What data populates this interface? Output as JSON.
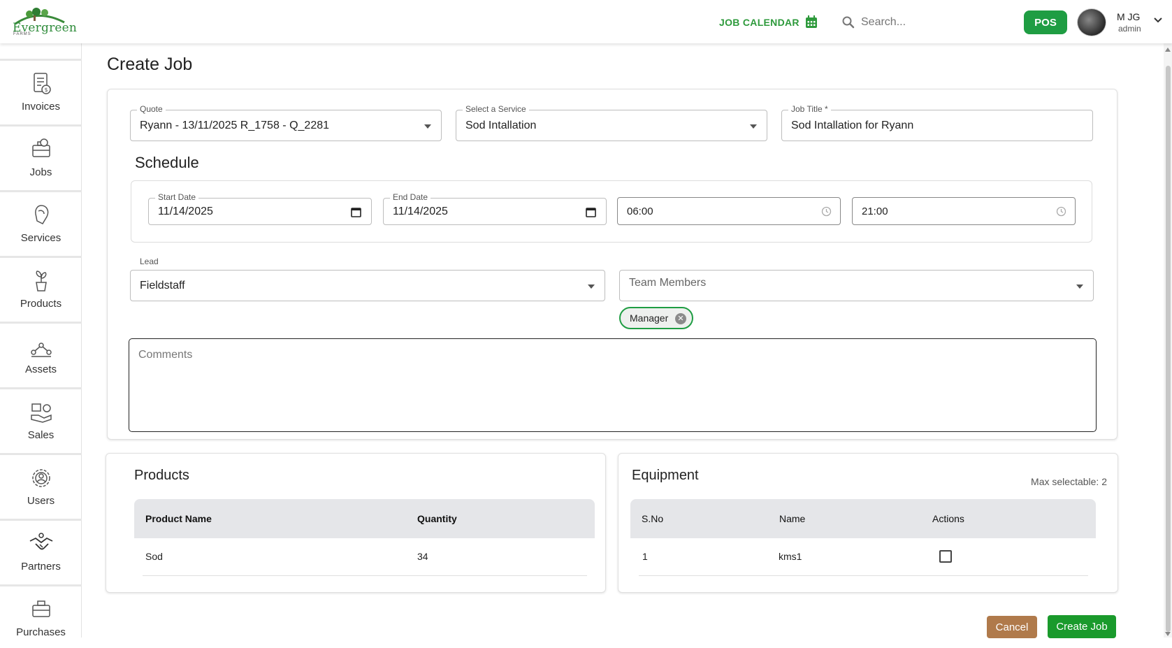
{
  "header": {
    "logo_text": "Evergreen",
    "logo_sub": "FARMS",
    "job_calendar_label": "JOB CALENDAR",
    "search_placeholder": "Search...",
    "pos_label": "POS",
    "user_name": "M JG",
    "user_role": "admin"
  },
  "sidebar": {
    "items": [
      {
        "label": "Invoices",
        "icon": "invoice-icon"
      },
      {
        "label": "Jobs",
        "icon": "jobs-icon"
      },
      {
        "label": "Services",
        "icon": "services-icon"
      },
      {
        "label": "Products",
        "icon": "plant-pot-icon"
      },
      {
        "label": "Assets",
        "icon": "assets-icon"
      },
      {
        "label": "Sales",
        "icon": "sales-icon"
      },
      {
        "label": "Users",
        "icon": "gear-users-icon"
      },
      {
        "label": "Partners",
        "icon": "handshake-icon"
      },
      {
        "label": "Purchases",
        "icon": "purchases-icon"
      }
    ]
  },
  "page": {
    "title": "Create Job"
  },
  "form": {
    "quote_label": "Quote",
    "quote_value": "Ryann - 13/11/2025 R_1758 - Q_2281",
    "service_label": "Select a Service",
    "service_value": "Sod Intallation",
    "job_title_label": "Job Title *",
    "job_title_value": "Sod Intallation for Ryann",
    "schedule_title": "Schedule",
    "start_date_label": "Start Date",
    "start_date_value": "11/14/2025",
    "end_date_label": "End Date",
    "end_date_value": "11/14/2025",
    "start_time_value": "06:00",
    "end_time_value": "21:00",
    "lead_label": "Lead",
    "lead_value": "Fieldstaff",
    "team_members_placeholder": "Team Members",
    "team_chip": "Manager",
    "comments_placeholder": "Comments"
  },
  "products": {
    "title": "Products",
    "columns": [
      "Product Name",
      "Quantity"
    ],
    "rows": [
      {
        "name": "Sod",
        "quantity": "34"
      }
    ]
  },
  "equipment": {
    "title": "Equipment",
    "max_selectable": "Max selectable: 2",
    "columns": [
      "S.No",
      "Name",
      "Actions"
    ],
    "rows": [
      {
        "sno": "1",
        "name": "kms1",
        "checked": false
      }
    ]
  },
  "actions": {
    "cancel_label": "Cancel",
    "create_label": "Create Job"
  },
  "colors": {
    "brand_green": "#1f9d43",
    "cancel_brown": "#b07a4b"
  }
}
